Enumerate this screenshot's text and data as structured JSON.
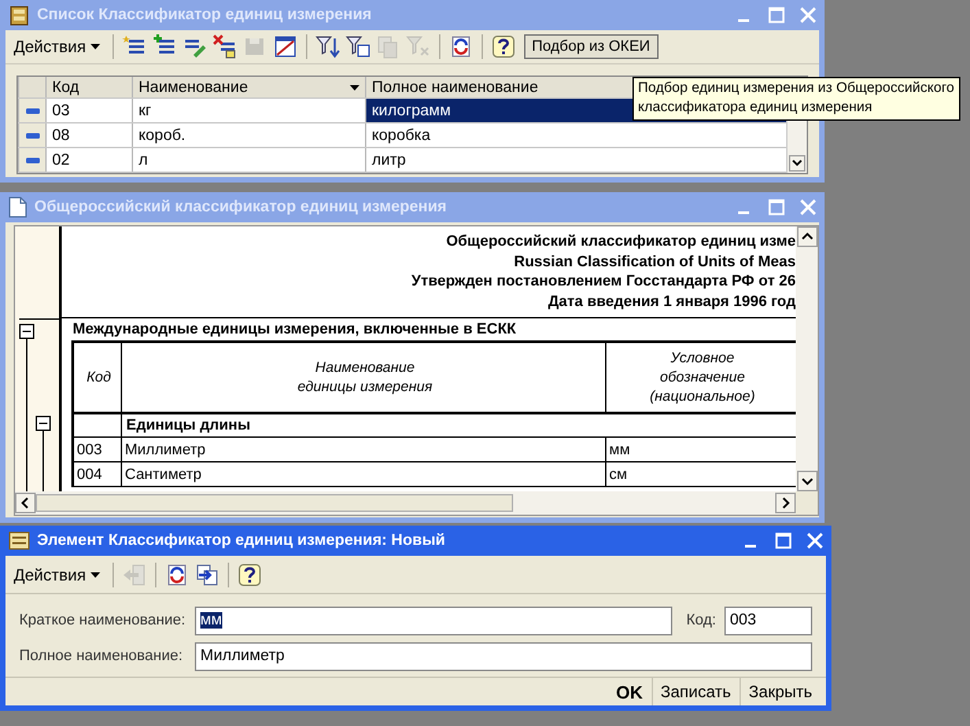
{
  "list_window": {
    "title": "Список Классификатор единиц измерения",
    "active": false,
    "toolbar": {
      "menu": "Действия",
      "icons": [
        {
          "kind": "add",
          "disabled": false
        },
        {
          "kind": "add-group",
          "disabled": false
        },
        {
          "kind": "edit",
          "disabled": false
        },
        {
          "kind": "delete",
          "disabled": false
        },
        {
          "kind": "save",
          "disabled": true
        },
        {
          "kind": "form",
          "disabled": false
        },
        {
          "kind": "filter",
          "disabled": false
        },
        {
          "kind": "filter-settings",
          "disabled": false
        },
        {
          "kind": "copy",
          "disabled": true
        },
        {
          "kind": "filter-clear",
          "disabled": true
        },
        {
          "kind": "refresh",
          "disabled": false
        },
        {
          "kind": "help",
          "disabled": false
        }
      ],
      "button": "Подбор из ОКЕИ"
    },
    "table": {
      "columns": [
        "Код",
        "Наименование",
        "Полное наименование"
      ],
      "rows": [
        {
          "code": "03",
          "name": "кг",
          "full_name": "килограмм",
          "selected": true
        },
        {
          "code": "08",
          "name": "короб.",
          "full_name": "коробка",
          "selected": false
        },
        {
          "code": "02",
          "name": "л",
          "full_name": "литр",
          "selected": false
        }
      ]
    },
    "tooltip": {
      "lines": [
        "Подбор единиц измерения из Общероссийского",
        "классификатора единиц измерения"
      ]
    }
  },
  "okei_window": {
    "title": "Общероссийский классификатор единиц измерения",
    "active": false,
    "header_lines": [
      "Общероссийский классификатор единиц изме",
      "Russian Classification of Units of Meas",
      "Утвержден постановлением Госстандарта РФ от 26",
      "Дата введения 1 января 1996 год"
    ],
    "section": {
      "title": "Международные единицы измерения, включенные в ЕСКК",
      "expanded": true,
      "columns": [
        [
          "Код"
        ],
        [
          "Наименование",
          "единицы измерения"
        ],
        [
          "Условное",
          "обозначение",
          "(национальное)"
        ]
      ],
      "group": {
        "title": "Единицы длины",
        "expanded": true,
        "rows": [
          {
            "code": "003",
            "name": "Миллиметр",
            "symbol": "мм"
          },
          {
            "code": "004",
            "name": "Сантиметр",
            "symbol": "см"
          }
        ]
      }
    }
  },
  "element_window": {
    "title": "Элемент Классификатор единиц измерения: Новый",
    "active": true,
    "toolbar": {
      "menu": "Действия",
      "icons": [
        {
          "kind": "back",
          "disabled": true
        },
        {
          "kind": "refresh",
          "disabled": false
        },
        {
          "kind": "transfer",
          "disabled": false
        },
        {
          "kind": "help",
          "disabled": false
        }
      ]
    },
    "short_name": {
      "label": "Краткое наименование:",
      "value": "мм",
      "selected": true
    },
    "code": {
      "label": "Код:",
      "value": "003"
    },
    "full_name": {
      "label": "Полное наименование:",
      "value": "Миллиметр"
    },
    "buttons": [
      {
        "label": "OK",
        "default": true
      },
      {
        "label": "Записать",
        "default": false
      },
      {
        "label": "Закрыть",
        "default": false
      }
    ]
  }
}
